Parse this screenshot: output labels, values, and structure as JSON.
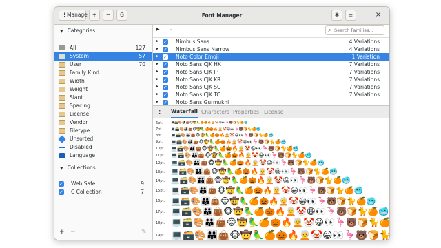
{
  "window": {
    "title": "Font Manager"
  },
  "titlebar": {
    "manage_label": "Manage",
    "add_label": "+",
    "remove_label": "−",
    "g_label": "G",
    "menu_icon": "hamburger-icon",
    "tools_icon": "tools-icon",
    "close_label": "×"
  },
  "sidebar": {
    "categories_header": "Categories",
    "categories": [
      {
        "label": "All",
        "count": "127",
        "icon": "drive-icon"
      },
      {
        "label": "System",
        "count": "57",
        "icon": "monitor-icon"
      },
      {
        "label": "User",
        "count": "70",
        "icon": "folder-icon"
      },
      {
        "label": "Family Kind",
        "count": "",
        "icon": "folder-icon"
      },
      {
        "label": "Width",
        "count": "",
        "icon": "folder-icon"
      },
      {
        "label": "Weight",
        "count": "",
        "icon": "folder-icon"
      },
      {
        "label": "Slant",
        "count": "",
        "icon": "folder-icon"
      },
      {
        "label": "Spacing",
        "count": "",
        "icon": "folder-icon"
      },
      {
        "label": "License",
        "count": "",
        "icon": "folder-icon"
      },
      {
        "label": "Vendor",
        "count": "",
        "icon": "folder-icon"
      },
      {
        "label": "Filetype",
        "count": "",
        "icon": "folder-icon"
      },
      {
        "label": "Unsorted",
        "count": "",
        "icon": "unsorted-icon"
      },
      {
        "label": "Disabled",
        "count": "",
        "icon": "disabled-icon"
      },
      {
        "label": "Language",
        "count": "",
        "icon": "language-icon"
      }
    ],
    "collections_header": "Collections",
    "collections": [
      {
        "label": "Web Safe",
        "count": "9"
      },
      {
        "label": "C Collection",
        "count": "7"
      }
    ],
    "footer_add": "+",
    "footer_remove": "−"
  },
  "fontlist": {
    "search_placeholder": "Search Families...",
    "collapse_label": "–",
    "rows": [
      {
        "name": "Nimbus Sans",
        "variations": "4 Variations"
      },
      {
        "name": "Nimbus Sans Narrow",
        "variations": "4 Variations"
      },
      {
        "name": "Noto Color Emoji",
        "variations": "1 Variation"
      },
      {
        "name": "Noto Sans CJK HK",
        "variations": "7 Variations"
      },
      {
        "name": "Noto Sans CJK JP",
        "variations": "7 Variations"
      },
      {
        "name": "Noto Sans CJK KR",
        "variations": "7 Variations"
      },
      {
        "name": "Noto Sans CJK SC",
        "variations": "7 Variations"
      },
      {
        "name": "Noto Sans CJK TC",
        "variations": "7 Variations"
      },
      {
        "name": "Noto Sans Gurmukhi",
        "variations": ""
      }
    ]
  },
  "preview": {
    "tabs": [
      "Waterfall",
      "Characters",
      "Properties",
      "License"
    ],
    "active_tab": "Waterfall",
    "sizes": [
      "6pt.",
      "7pt.",
      "8pt.",
      "9pt.",
      "10pt.",
      "11pt.",
      "12pt.",
      "13pt.",
      "14pt.",
      "15pt.",
      "16pt.",
      "17pt.",
      "18pt.",
      "19pt.",
      "20pt."
    ],
    "sample": "💻🗃️🎨👪👜🐵🤠🦜🍊🎃🔥🧑‍🦳🤡😀👀🦩🐻🍞🐈🍊🥶"
  },
  "colors": {
    "accent": "#3584e4",
    "window_bg": "#ffffff",
    "header_bg": "#e8e8e7"
  }
}
